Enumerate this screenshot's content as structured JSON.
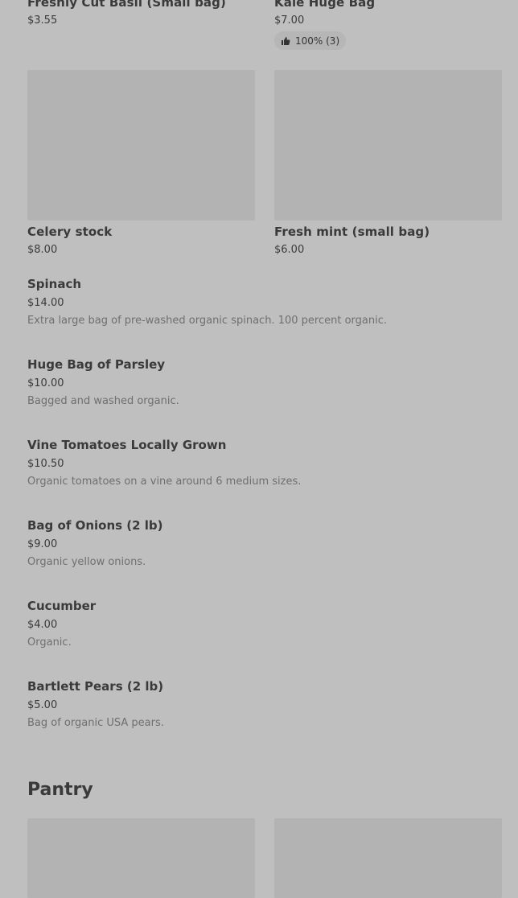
{
  "top_cards": [
    {
      "title": "Freshly Cut Basil (Small bag)",
      "price": "$3.55"
    },
    {
      "title": "Kale Huge Bag",
      "price": "$7.00",
      "rating": "100% (3)"
    }
  ],
  "image_cards": [
    {
      "title": "Celery stock",
      "price": "$8.00"
    },
    {
      "title": "Fresh mint (small bag)",
      "price": "$6.00"
    }
  ],
  "list_items": [
    {
      "title": "Spinach",
      "price": "$14.00",
      "description": "Extra large bag of pre-washed organic spinach. 100 percent organic."
    },
    {
      "title": "Huge Bag of Parsley",
      "price": "$10.00",
      "description": "Bagged and washed organic."
    },
    {
      "title": "Vine Tomatoes Locally Grown",
      "price": "$10.50",
      "description": "Organic tomatoes on a vine around 6 medium sizes."
    },
    {
      "title": "Bag of Onions (2 lb)",
      "price": "$9.00",
      "description": "Organic yellow onions."
    },
    {
      "title": "Cucumber",
      "price": "$4.00",
      "description": "Organic."
    },
    {
      "title": "Bartlett Pears (2 lb)",
      "price": "$5.00",
      "description": "Bag of organic USA pears."
    }
  ],
  "section": {
    "title": "Pantry"
  },
  "icons": {
    "rating": "thumbs-up-icon"
  }
}
